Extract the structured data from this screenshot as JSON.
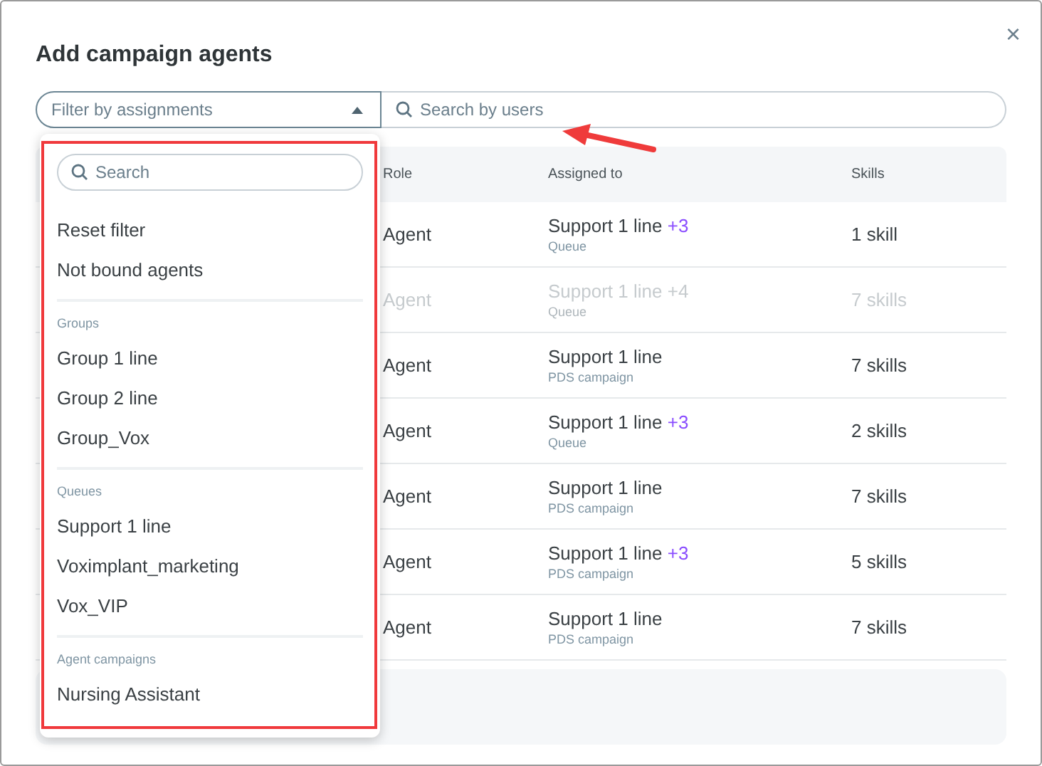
{
  "dialog": {
    "title": "Add campaign agents",
    "close": "×"
  },
  "filter": {
    "placeholder": "Filter by assignments",
    "expanded": true
  },
  "search": {
    "placeholder": "Search by users"
  },
  "table": {
    "columns": [
      "Role",
      "Assigned to",
      "Skills"
    ],
    "rows": [
      {
        "role": "Agent",
        "assigned": "Support 1 line",
        "extra": "+3",
        "type": "Queue",
        "skills": "1 skill",
        "disabled": false
      },
      {
        "role": "Agent",
        "assigned": "Support 1 line",
        "extra": "+4",
        "type": "Queue",
        "skills": "7 skills",
        "disabled": true
      },
      {
        "role": "Agent",
        "assigned": "Support 1 line",
        "type": "PDS campaign",
        "skills": "7 skills",
        "disabled": false
      },
      {
        "role": "Agent",
        "assigned": "Support 1 line",
        "extra": "+3",
        "type": "Queue",
        "skills": "2 skills",
        "disabled": false
      },
      {
        "role": "Agent",
        "assigned": "Support 1 line",
        "type": "PDS campaign",
        "skills": "7 skills",
        "disabled": false
      },
      {
        "role": "Agent",
        "assigned": "Support 1 line",
        "extra": "+3",
        "type": "PDS campaign",
        "skills": "5 skills",
        "disabled": false
      },
      {
        "role": "Agent",
        "assigned": "Support 1 line",
        "type": "PDS campaign",
        "skills": "7 skills",
        "disabled": false
      }
    ]
  },
  "dropdown": {
    "search_placeholder": "Search",
    "items": [
      "Reset filter",
      "Not bound agents"
    ],
    "sections": [
      {
        "label": "Groups",
        "items": [
          "Group 1 line",
          "Group 2 line",
          "Group_Vox"
        ]
      },
      {
        "label": "Queues",
        "items": [
          "Support 1 line",
          "Voximplant_marketing",
          "Vox_VIP"
        ]
      },
      {
        "label": "Agent campaigns",
        "items": [
          "Nursing Assistant"
        ]
      }
    ]
  }
}
